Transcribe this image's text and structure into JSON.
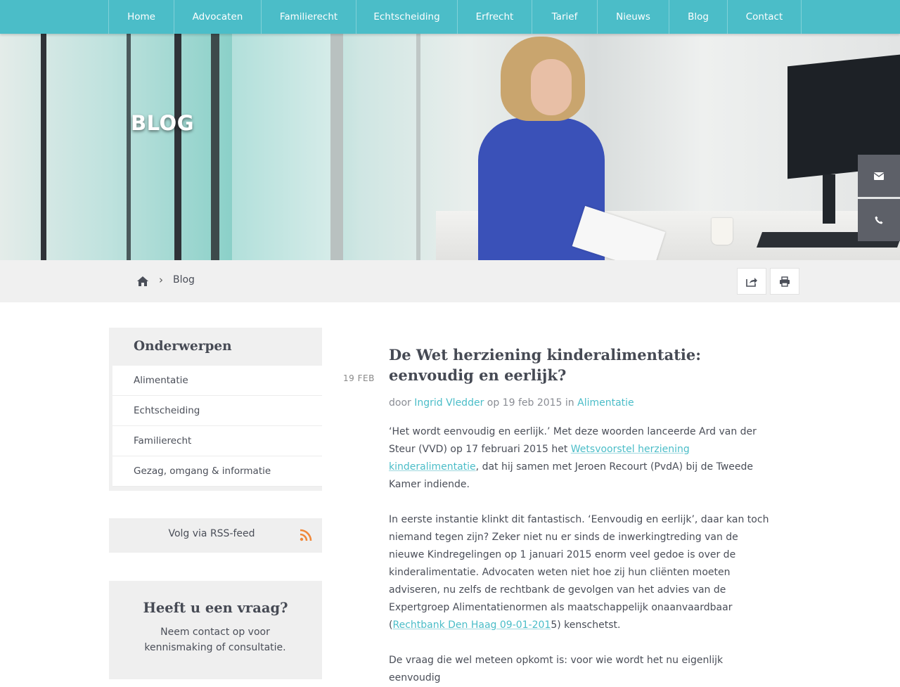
{
  "nav": {
    "items": [
      "Home",
      "Advocaten",
      "Familierecht",
      "Echtscheiding",
      "Erfrecht",
      "Tarief",
      "Nieuws",
      "Blog",
      "Contact"
    ]
  },
  "hero": {
    "title": "BLOG"
  },
  "side_buttons": {
    "mail_icon": "envelope-icon",
    "phone_icon": "phone-icon"
  },
  "breadcrumb": {
    "home_icon": "home-icon",
    "current": "Blog"
  },
  "tools": {
    "share_icon": "share-icon",
    "print_icon": "print-icon"
  },
  "sidebar": {
    "title": "Onderwerpen",
    "topics": [
      "Alimentatie",
      "Echtscheiding",
      "Familierecht",
      "Gezag, omgang & informatie"
    ],
    "rss_label": "Volg via RSS-feed",
    "ask_title": "Heeft u een vraag?",
    "ask_text": "Neem contact op voor kennismaking of consultatie."
  },
  "article": {
    "date": "19 FEB",
    "title": "De Wet herziening kinderalimentatie: eenvoudig en eerlijk?",
    "meta_by": "door",
    "author": "Ingrid Vledder",
    "meta_on": "op 19 feb 2015 in",
    "category": "Alimentatie",
    "p1_a": "‘Het wordt eenvoudig en eerlijk.’ Met deze woorden lanceerde Ard van der Steur (VVD) op 17 februari 2015 het ",
    "p1_link": "Wetsvoorstel herziening kinderalimentatie",
    "p1_b": ", dat hij samen met Jeroen Recourt (PvdA) bij de Tweede Kamer indiende.",
    "p2_a": "In eerste instantie klinkt dit fantastisch. ‘Eenvoudig en eerlijk’, daar kan toch niemand tegen zijn? Zeker niet nu er sinds de inwerkingtreding van de nieuwe Kindregelingen op 1 januari 2015 enorm veel gedoe is over de kinderalimentatie. Advocaten weten niet hoe zij hun cliënten moeten adviseren, nu zelfs de rechtbank de gevolgen van het advies van de Expertgroep Alimentatienormen als maatschappelijk onaanvaardbaar (",
    "p2_link": "Rechtbank Den Haag 09-01-201",
    "p2_b": "5) kenschetst.",
    "p3": "De vraag die wel meteen opkomt is: voor wie wordt het nu eigenlijk eenvoudig"
  },
  "colors": {
    "accent": "#4bbdc8",
    "dark_button": "#5d6068",
    "panel": "#f0f0f0",
    "rss": "#f0883a"
  }
}
